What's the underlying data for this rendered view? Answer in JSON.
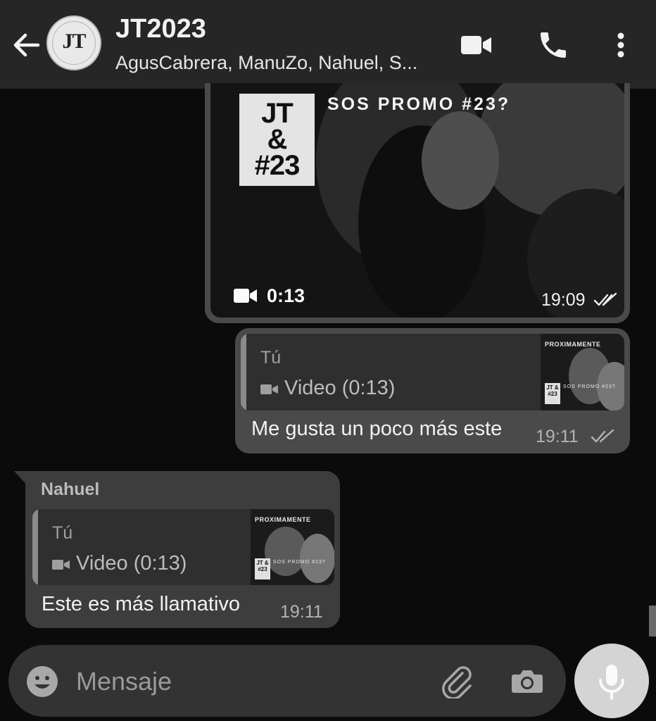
{
  "header": {
    "back_icon": "arrow-left-icon",
    "avatar_monogram": "JT",
    "title": "JT2023",
    "participants": "AgusCabrera, ManuZo, Nahuel, S...",
    "video_call_icon": "video-camera-icon",
    "voice_call_icon": "phone-icon",
    "menu_icon": "more-vertical-icon"
  },
  "messages": [
    {
      "type": "video",
      "direction": "outgoing",
      "overlay_box": [
        "JT",
        "&",
        "#23"
      ],
      "overlay_title": "SOS PROMO #23?",
      "duration": "0:13",
      "time": "19:09",
      "status_icon": "double-check-icon"
    },
    {
      "type": "reply",
      "direction": "outgoing",
      "quote": {
        "author": "Tú",
        "text": "Video (0:13)",
        "icon": "video-camera-icon",
        "thumb_title": "PROXIMAMENTE",
        "thumb_box": "JT & #23",
        "thumb_caption": "SOS PROMO #23?"
      },
      "text": "Me gusta un poco más este",
      "time": "19:11",
      "status_icon": "double-check-icon"
    },
    {
      "type": "reply",
      "direction": "incoming",
      "sender": "Nahuel",
      "quote": {
        "author": "Tú",
        "text": "Video (0:13)",
        "icon": "video-camera-icon",
        "thumb_title": "PROXIMAMENTE",
        "thumb_box": "JT & #23",
        "thumb_caption": "SOS PROMO #23?"
      },
      "text": "Este es más llamativo",
      "time": "19:11"
    }
  ],
  "composer": {
    "placeholder": "Mensaje",
    "emoji_icon": "emoji-icon",
    "attach_icon": "paperclip-icon",
    "camera_icon": "camera-icon",
    "mic_icon": "microphone-icon"
  },
  "colors": {
    "header_bg": "#262626",
    "chat_bg": "#0b0b0b",
    "outgoing_bubble": "#4a4a4a",
    "incoming_bubble": "#3d3d3d",
    "mic_button": "#d4d4d4"
  }
}
